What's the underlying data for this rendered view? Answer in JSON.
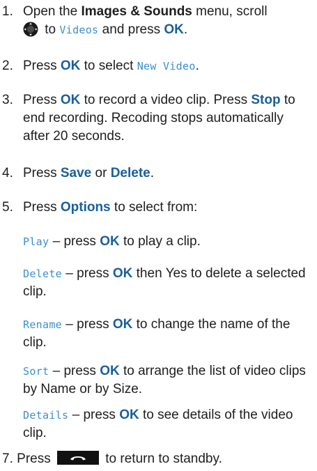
{
  "steps": {
    "s1": {
      "num": "1.",
      "t1": "Open the ",
      "menu": "Images & Sounds",
      "t2": " menu, scroll",
      "t3": " to ",
      "screen": "Videos",
      "t4": " and press ",
      "ok": "OK",
      "t5": "."
    },
    "s2": {
      "num": "2.",
      "t1": "Press ",
      "ok": "OK",
      "t2": " to select ",
      "screen": "New Video",
      "t3": "."
    },
    "s3": {
      "num": "3.",
      "t1": "Press ",
      "ok": "OK",
      "t2": " to record a video clip. Press ",
      "stop": "Stop",
      "t3": " to end recording. Recoding stops automatically after 20 seconds."
    },
    "s4": {
      "num": "4.",
      "t1": "Press ",
      "save": "Save",
      "t2": " or ",
      "del": "Delete",
      "t3": "."
    },
    "s5": {
      "num": "5.",
      "t1": "Press ",
      "options": "Options",
      "t2": " to select from:"
    },
    "options": [
      {
        "label": "Play",
        "t1": " – press ",
        "ok": "OK",
        "t2": " to play a clip."
      },
      {
        "label": "Delete",
        "t1": " – press ",
        "ok": "OK",
        "t2": " then Yes to delete a selected clip."
      },
      {
        "label": "Rename",
        "t1": " – press ",
        "ok": "OK",
        "t2": " to change the name of the clip."
      },
      {
        "label": "Sort",
        "t1": " – press ",
        "ok": "OK",
        "t2": " to arrange the list of video clips by Name or by Size."
      },
      {
        "label": "Details",
        "t1": " – press ",
        "ok": "OK",
        "t2": " to see details of the video clip."
      }
    ],
    "s7": {
      "num": "7.",
      "t1": "Press ",
      "t2": " to return to standby."
    }
  },
  "icons": {
    "nav_key": "navigation-key-icon",
    "end_call": "end-call-key-icon"
  },
  "colors": {
    "keyword_blue": "#1a5f9a",
    "screen_text_blue": "#3b8fcf",
    "body_text": "#1e1e1e"
  }
}
